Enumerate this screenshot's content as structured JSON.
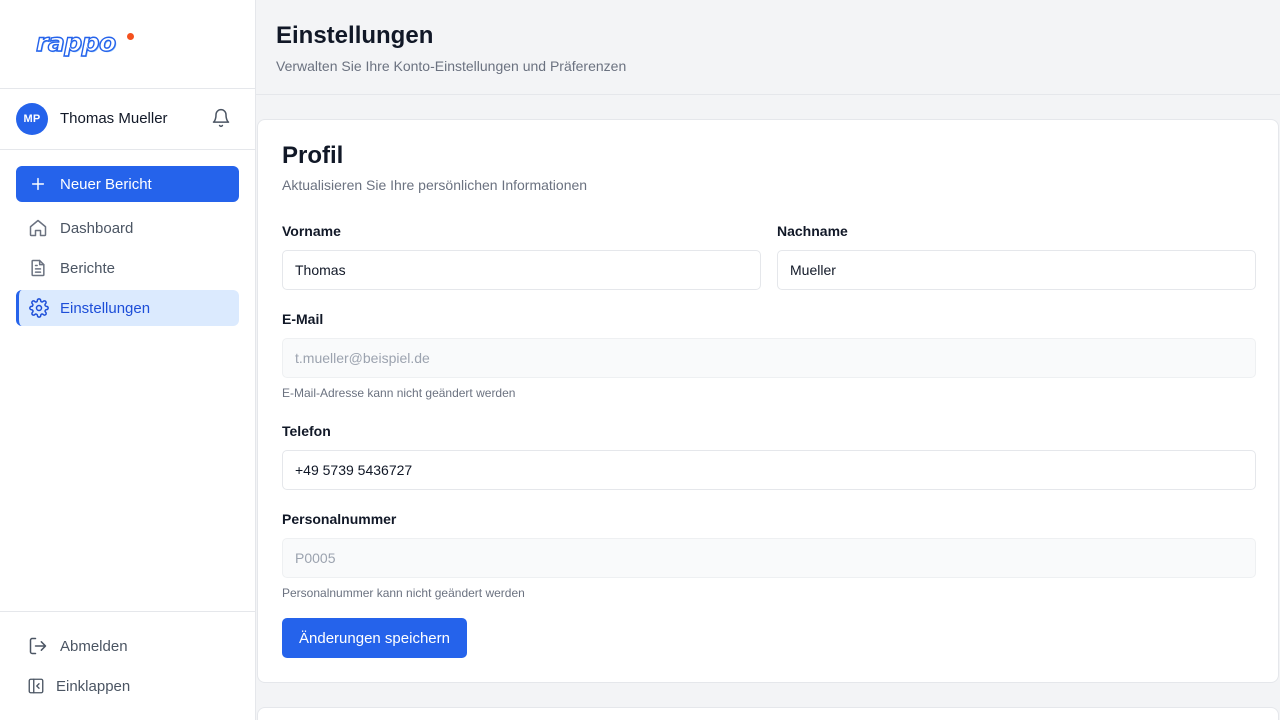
{
  "app": {
    "logo_text": "rappo",
    "brand_color": "#2563eb",
    "logo_dot_color": "#f4511e"
  },
  "user": {
    "initials": "MP",
    "name": "Thomas Mueller",
    "notification_icon": "bell-icon"
  },
  "sidebar": {
    "new_report_label": "Neuer Bericht",
    "items": [
      {
        "label": "Dashboard",
        "icon": "home-icon",
        "active": false
      },
      {
        "label": "Berichte",
        "icon": "document-icon",
        "active": false
      },
      {
        "label": "Einstellungen",
        "icon": "gear-icon",
        "active": true
      }
    ],
    "bottom": [
      {
        "label": "Abmelden",
        "icon": "logout-icon"
      },
      {
        "label": "Einklappen",
        "icon": "collapse-icon"
      }
    ]
  },
  "header": {
    "title": "Einstellungen",
    "subtitle": "Verwalten Sie Ihre Konto-Einstellungen und Präferenzen"
  },
  "profile": {
    "title": "Profil",
    "subtitle": "Aktualisieren Sie Ihre persönlichen Informationen",
    "first_name": {
      "label": "Vorname",
      "value": "Thomas"
    },
    "last_name": {
      "label": "Nachname",
      "value": "Mueller"
    },
    "email": {
      "label": "E-Mail",
      "value": "t.mueller@beispiel.de",
      "hint": "E-Mail-Adresse kann nicht geändert werden"
    },
    "phone": {
      "label": "Telefon",
      "value": "+49 5739 5436727"
    },
    "personnel_number": {
      "label": "Personalnummer",
      "value": "P0005",
      "hint": "Personalnummer kann nicht geändert werden"
    },
    "save_label": "Änderungen speichern"
  }
}
